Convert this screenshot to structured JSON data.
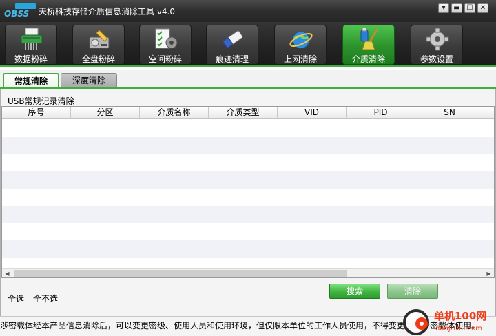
{
  "window": {
    "logo_text": "OBSS",
    "title": "天桥科技存储介质信息消除工具 v4.0",
    "controls": [
      "▾",
      "▬",
      "☐",
      "✕"
    ]
  },
  "toolbar": {
    "items": [
      {
        "label": "数据粉碎",
        "icon": "shredder-icon"
      },
      {
        "label": "全盘粉碎",
        "icon": "disk-shredder-icon"
      },
      {
        "label": "空间粉碎",
        "icon": "checklist-gear-icon"
      },
      {
        "label": "痕迹清理",
        "icon": "eraser-icon"
      },
      {
        "label": "上网清除",
        "icon": "ie-globe-icon"
      },
      {
        "label": "介质清除",
        "icon": "usb-broom-icon",
        "active": true
      },
      {
        "label": "参数设置",
        "icon": "gear-icon"
      }
    ]
  },
  "tabs": [
    {
      "label": "常规清除",
      "active": true
    },
    {
      "label": "深度清除",
      "active": false
    }
  ],
  "section": {
    "label": "USB常规记录清除"
  },
  "table": {
    "columns": [
      "序号",
      "分区",
      "介质名称",
      "介质类型",
      "VID",
      "PID",
      "SN"
    ],
    "rows": []
  },
  "actions": {
    "select_all": "全选",
    "select_none": "全不选",
    "search": "搜索",
    "clear": "清除"
  },
  "status": {
    "text": "涉密载体经本产品信息消除后，可以变更密级、使用人员和使用环境，但仅限本单位的工作人员使用，不得变更为非涉密载体使用。"
  },
  "watermark": {
    "text_top": "单机100网",
    "text_bottom": "danji100.com"
  },
  "colors": {
    "accent_green": "#3fae3f",
    "titlebar": "#2e2e2e"
  }
}
